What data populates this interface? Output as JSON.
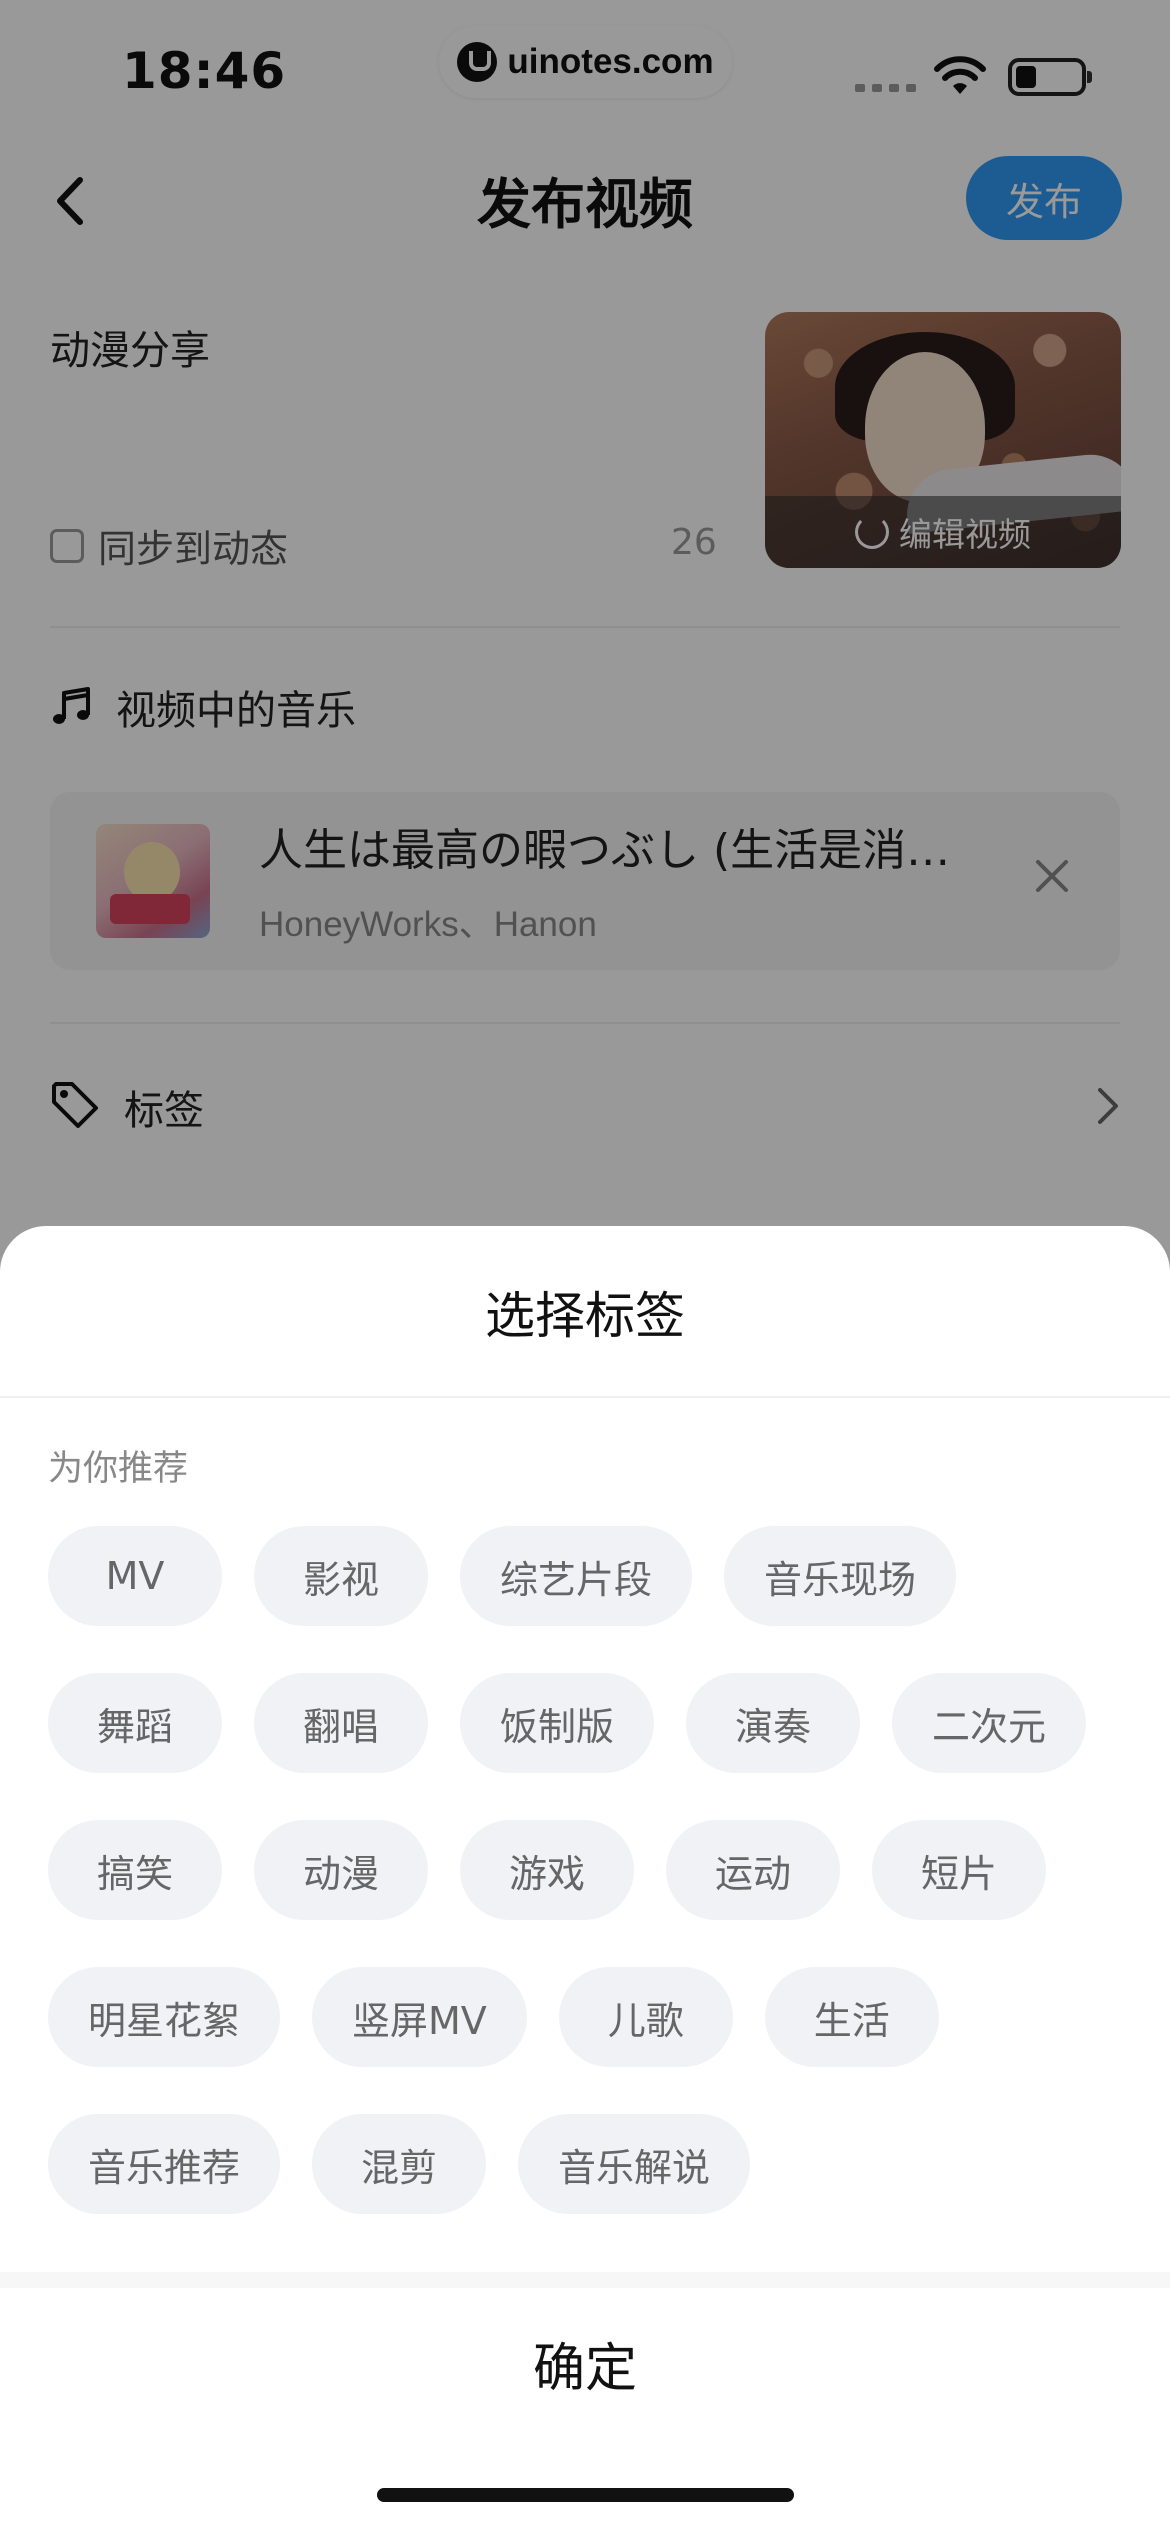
{
  "status_bar": {
    "time": "18:46",
    "url": "uinotes.com"
  },
  "nav": {
    "title": "发布视频",
    "publish_label": "发布"
  },
  "post": {
    "description": "动漫分享",
    "sync_label": "同步到动态",
    "char_count": "26",
    "edit_video_label": "编辑视频"
  },
  "music": {
    "section_label": "视频中的音乐",
    "song_title": "人生は最高の暇つぶし (生活是消…",
    "artist": "HoneyWorks、Hanon"
  },
  "tags_row": {
    "label": "标签"
  },
  "sheet": {
    "title": "选择标签",
    "recommend_label": "为你推荐",
    "chip_rows": [
      [
        "MV",
        "影视",
        "综艺片段",
        "音乐现场"
      ],
      [
        "舞蹈",
        "翻唱",
        "饭制版",
        "演奏",
        "二次元"
      ],
      [
        "搞笑",
        "动漫",
        "游戏",
        "运动",
        "短片"
      ],
      [
        "明星花絮",
        "竖屏MV",
        "儿歌",
        "生活"
      ],
      [
        "音乐推荐",
        "混剪",
        "音乐解说"
      ]
    ],
    "confirm_label": "确定"
  },
  "colors": {
    "accent": "#2f9af6",
    "chip_bg": "#f1f2f6",
    "chip_text": "#666666"
  }
}
